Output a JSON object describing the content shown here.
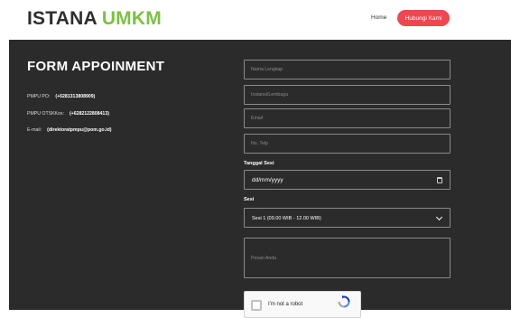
{
  "header": {
    "brand_part1": "ISTANA",
    "brand_part2": "UMKM",
    "nav_home": "Home",
    "nav_contact": "Hubungi Kami"
  },
  "main": {
    "title": "FORM APPOINMENT",
    "contacts": [
      {
        "label": "PMPU PO:",
        "value": "(+6281313808909)"
      },
      {
        "label": "PMPU OTSKKos:",
        "value": "(+6282122808413)"
      },
      {
        "label": "E-mail:",
        "value": "(direktoratpmpu@pom.go.id)"
      }
    ]
  },
  "form": {
    "name_placeholder": "Nama Lengkap",
    "institution_placeholder": "Instansi/Lembaga",
    "email_placeholder": "Email",
    "phone_placeholder": "No. Telp",
    "date_label": "Tanggal Sesi",
    "date_value": "dd/mm/yyyy",
    "session_label": "Sesi",
    "session_value": "Sesi 1 (09.00 WIB - 12.00 WIB)",
    "message_placeholder": "Pesan Anda",
    "captcha_label": "I'm not a robot"
  },
  "colors": {
    "accent_green": "#7cc142",
    "accent_red": "#e94a4f",
    "panel_bg": "#2b2b2b"
  }
}
